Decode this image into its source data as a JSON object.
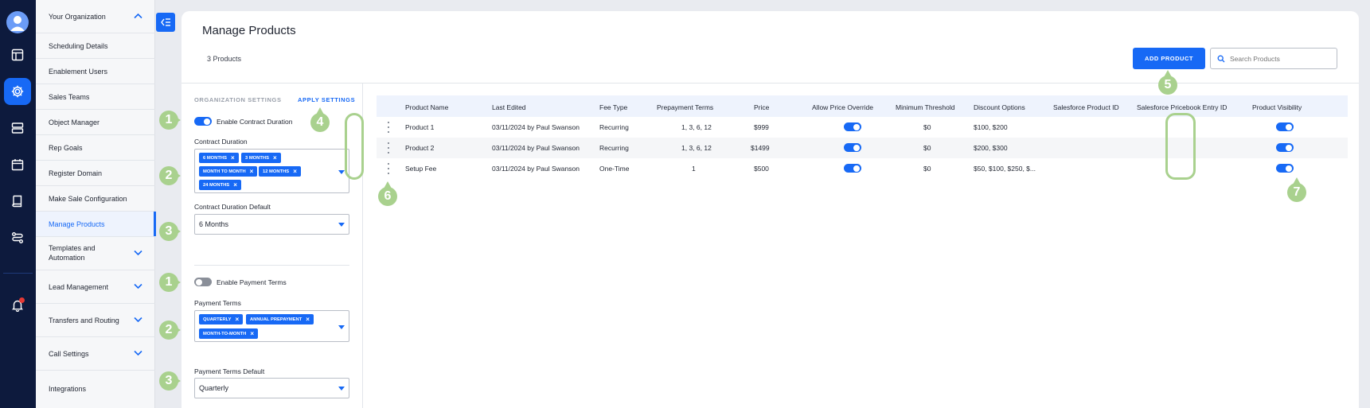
{
  "rail": {
    "icons": [
      "user-avatar-icon",
      "dashboard-icon",
      "settings-icon",
      "server-icon",
      "calendar-icon",
      "book-icon",
      "workflow-icon",
      "bell-icon"
    ],
    "active": "settings-icon",
    "accent": "#1769f5",
    "background": "#0d1a3d"
  },
  "nav": {
    "section": "Your Organization",
    "items": [
      {
        "label": "Scheduling Details"
      },
      {
        "label": "Enablement Users"
      },
      {
        "label": "Sales Teams"
      },
      {
        "label": "Object Manager"
      },
      {
        "label": "Rep Goals"
      },
      {
        "label": "Register Domain"
      },
      {
        "label": "Make Sale Configuration"
      },
      {
        "label": "Manage Products"
      }
    ],
    "groups": [
      {
        "label": "Templates and Automation"
      },
      {
        "label": "Lead Management"
      },
      {
        "label": "Transfers and Routing"
      },
      {
        "label": "Call Settings"
      }
    ],
    "last": "Integrations",
    "selected": "Manage Products"
  },
  "page": {
    "title": "Manage Products",
    "count": "3 Products",
    "add_button": "ADD PRODUCT",
    "search_placeholder": "Search Products"
  },
  "settings": {
    "tab_org": "ORGANIZATION SETTINGS",
    "tab_apply": "APPLY SETTINGS",
    "contract": {
      "toggle_label": "Enable Contract Duration",
      "enabled": true,
      "duration_label": "Contract Duration",
      "chips": [
        "6 MONTHS",
        "3 MONTHS",
        "MONTH TO MONTH",
        "12 MONTHS",
        "24 MONTHS"
      ],
      "default_label": "Contract Duration Default",
      "default_value": "6 Months"
    },
    "payment": {
      "toggle_label": "Enable Payment Terms",
      "enabled": false,
      "terms_label": "Payment Terms",
      "chips": [
        "QUARTERLY",
        "ANNUAL PREPAYMENT",
        "MONTH-TO-MONTH"
      ],
      "default_label": "Payment Terms Default",
      "default_value": "Quarterly"
    }
  },
  "table": {
    "headers": [
      "Product Name",
      "Last Edited",
      "Fee Type",
      "Prepayment Terms",
      "Price",
      "Allow Price Override",
      "Minimum Threshold",
      "Discount Options",
      "Salesforce Product ID",
      "Salesforce Pricebook Entry ID",
      "Product Visibility"
    ],
    "rows": [
      {
        "name": "Product 1",
        "edited": "03/11/2024 by Paul Swanson",
        "fee": "Recurring",
        "terms": "1, 3, 6, 12",
        "price": "$999",
        "override": true,
        "threshold": "$0",
        "discounts": "$100, $200",
        "sf_product": "",
        "sf_pricebook": "",
        "visible": true
      },
      {
        "name": "Product 2",
        "edited": "03/11/2024 by Paul Swanson",
        "fee": "Recurring",
        "terms": "1, 3, 6, 12",
        "price": "$1499",
        "override": true,
        "threshold": "$0",
        "discounts": "$200, $300",
        "sf_product": "",
        "sf_pricebook": "",
        "visible": true
      },
      {
        "name": "Setup Fee",
        "edited": "03/11/2024 by Paul Swanson",
        "fee": "One-Time",
        "terms": "1",
        "price": "$500",
        "override": true,
        "threshold": "$0",
        "discounts": "$50, $100, $250, $...",
        "sf_product": "",
        "sf_pricebook": "",
        "visible": true
      }
    ]
  },
  "annotations": {
    "m1a": "1",
    "m2a": "2",
    "m3a": "3",
    "m4": "4",
    "m5": "5",
    "m1b": "1",
    "m2b": "2",
    "m3b": "3",
    "m6": "6",
    "m7": "7",
    "color": "#a9d18e"
  }
}
